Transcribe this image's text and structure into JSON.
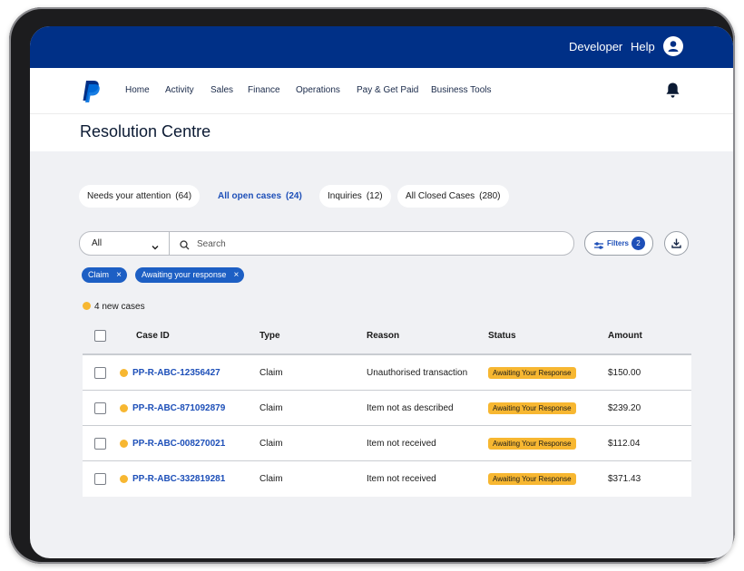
{
  "header": {
    "developer_label": "Developer",
    "help_label": "Help",
    "brand_color": "#003087"
  },
  "nav": {
    "items": [
      {
        "label": "Home"
      },
      {
        "label": "Activity"
      },
      {
        "label": "Sales"
      },
      {
        "label": "Finance"
      },
      {
        "label": "Operations"
      },
      {
        "label": "Pay & Get Paid"
      },
      {
        "label": "Business Tools"
      }
    ]
  },
  "page": {
    "title": "Resolution Centre"
  },
  "tabs": [
    {
      "label": "Needs your attention",
      "count": "(64)"
    },
    {
      "label": "All open cases",
      "count": "(24)"
    },
    {
      "label": "Inquiries",
      "count": "(12)"
    },
    {
      "label": "All Closed Cases",
      "count": "(280)"
    }
  ],
  "search": {
    "select_value": "All",
    "placeholder": "Search"
  },
  "filters": {
    "label": "Filters",
    "count": "2"
  },
  "chips": [
    {
      "label": "Claim"
    },
    {
      "label": "Awaiting your response"
    }
  ],
  "new_cases_label": "4 new cases",
  "table": {
    "headers": {
      "case_id": "Case ID",
      "type": "Type",
      "reason": "Reason",
      "status": "Status",
      "amount": "Amount"
    },
    "rows": [
      {
        "case_id": "PP-R-ABC-12356427",
        "type": "Claim",
        "reason": "Unauthorised transaction",
        "status": "Awaiting Your Response",
        "amount": "$150.00"
      },
      {
        "case_id": "PP-R-ABC-871092879",
        "type": "Claim",
        "reason": "Item not as described",
        "status": "Awaiting Your Response",
        "amount": "$239.20"
      },
      {
        "case_id": "PP-R-ABC-008270021",
        "type": "Claim",
        "reason": "Item not received",
        "status": "Awaiting Your Response",
        "amount": "$112.04"
      },
      {
        "case_id": "PP-R-ABC-332819281",
        "type": "Claim",
        "reason": "Item not received",
        "status": "Awaiting Your Response",
        "amount": "$371.43"
      }
    ]
  },
  "colors": {
    "accent": "#1d4fb8",
    "status_awaiting": "#f7b731",
    "chip": "#1d5fc4"
  }
}
